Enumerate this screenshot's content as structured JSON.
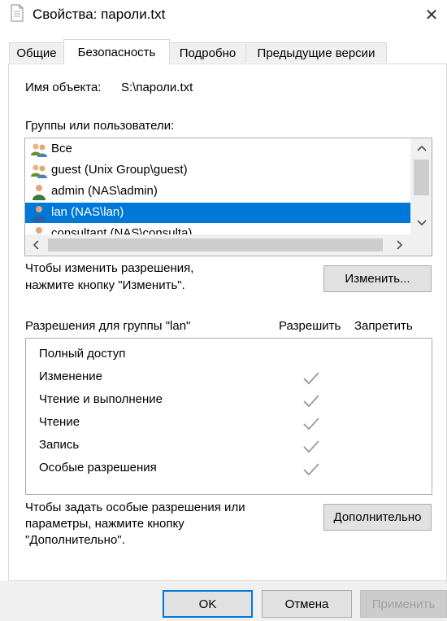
{
  "window": {
    "title": "Свойства: пароли.txt",
    "close_glyph": "✕"
  },
  "tabs": [
    {
      "label": "Общие"
    },
    {
      "label": "Безопасность"
    },
    {
      "label": "Подробно"
    },
    {
      "label": "Предыдущие версии"
    }
  ],
  "active_tab": "Безопасность",
  "object": {
    "label": "Имя объекта:",
    "value": "S:\\пароли.txt"
  },
  "groups": {
    "label": "Группы или пользователи:",
    "items": [
      {
        "name": "Все",
        "icon": "group-users-icon",
        "selected": false
      },
      {
        "name": "guest (Unix Group\\guest)",
        "icon": "group-users-icon",
        "selected": false
      },
      {
        "name": "admin (NAS\\admin)",
        "icon": "user-icon",
        "selected": false
      },
      {
        "name": "lan (NAS\\lan)",
        "icon": "user-icon",
        "selected": true
      },
      {
        "name": "consultant (NAS\\consulta)",
        "icon": "user-icon",
        "selected": false
      }
    ]
  },
  "change_hint": {
    "line1": "Чтобы изменить разрешения,",
    "line2": "нажмите кнопку \"Изменить\"."
  },
  "change_button": "Изменить...",
  "permissions": {
    "header": "Разрешения для группы \"lan\"",
    "allow_label": "Разрешить",
    "deny_label": "Запретить",
    "rows": [
      {
        "name": "Полный доступ",
        "allow": false
      },
      {
        "name": "Изменение",
        "allow": true
      },
      {
        "name": "Чтение и выполнение",
        "allow": true
      },
      {
        "name": "Чтение",
        "allow": true
      },
      {
        "name": "Запись",
        "allow": true
      },
      {
        "name": "Особые разрешения",
        "allow": true
      }
    ]
  },
  "advanced_hint": {
    "line1": "Чтобы задать особые разрешения или",
    "line2": "параметры, нажмите кнопку",
    "line3": "\"Дополнительно\"."
  },
  "advanced_button": "Дополнительно",
  "footer": {
    "ok": "OK",
    "cancel": "Отмена",
    "apply": "Применить"
  },
  "colors": {
    "selection": "#0078d7",
    "check_disabled": "#a0a0a0"
  }
}
